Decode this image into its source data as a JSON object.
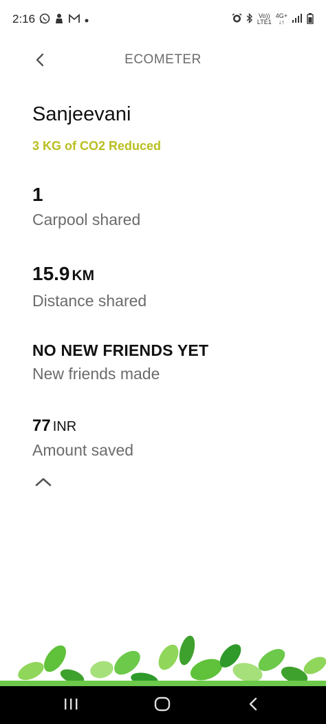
{
  "status_bar": {
    "time": "2:16",
    "network_volte": "Vo))",
    "network_lte": "LTE1",
    "network_4g": "4G+"
  },
  "header": {
    "title": "ECOMETER"
  },
  "user": {
    "name": "Sanjeevani",
    "co2_reduced": "3 KG of CO2 Reduced"
  },
  "stats": {
    "carpool": {
      "value": "1",
      "label": "Carpool shared"
    },
    "distance": {
      "value": "15.9",
      "unit": "KM",
      "label": "Distance shared"
    },
    "friends": {
      "value": "NO NEW FRIENDS YET",
      "label": "New friends made"
    },
    "amount": {
      "value": "77",
      "unit": "INR",
      "label": "Amount saved"
    }
  },
  "colors": {
    "accent": "#b9bf21",
    "label_gray": "#6b6b6b",
    "leaf_green": "#5fc23a"
  },
  "icons": {
    "back": "chevron-left-icon",
    "collapse": "chevron-up-icon"
  }
}
